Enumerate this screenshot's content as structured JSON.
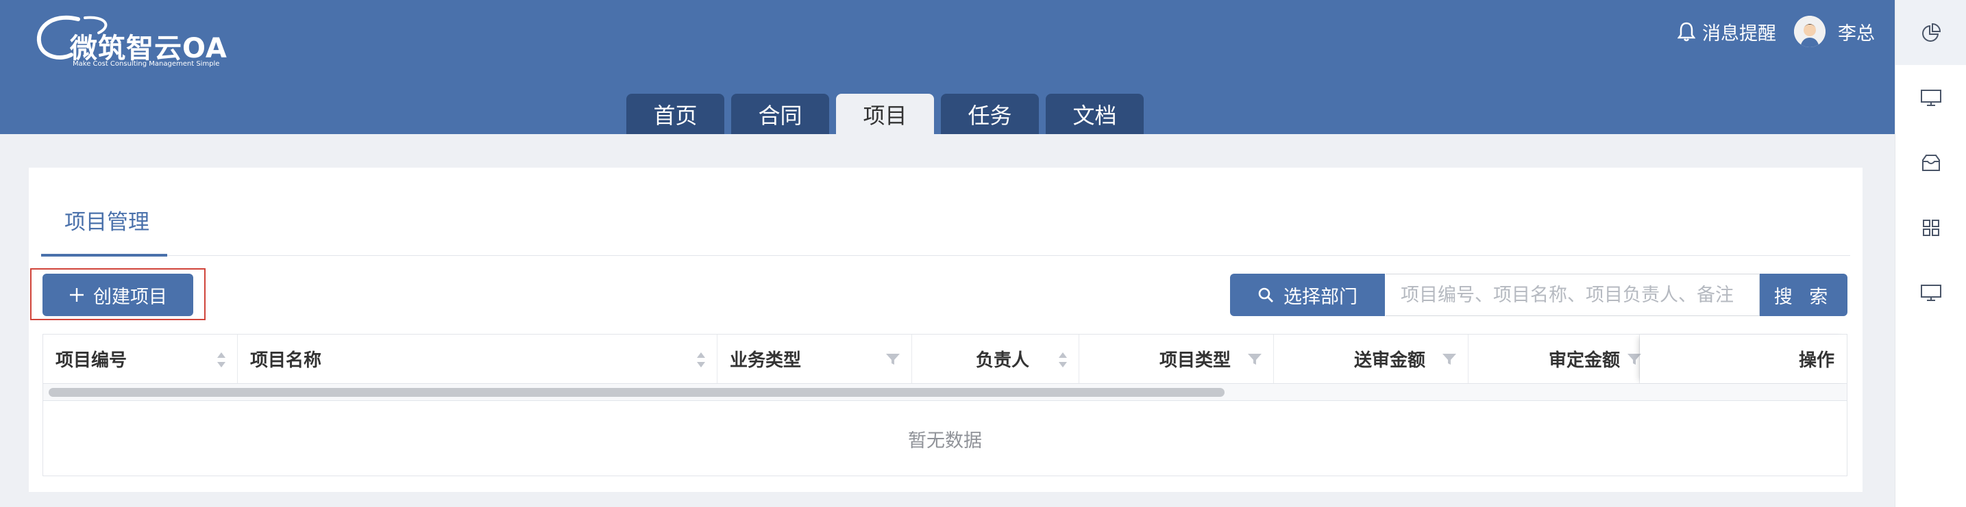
{
  "header": {
    "logo_text": "微筑智云OA",
    "logo_sub": "Make Cost Consulting Management Simple",
    "notice_label": "消息提醒",
    "user_name": "李总",
    "tabs": [
      {
        "label": "首页"
      },
      {
        "label": "合同"
      },
      {
        "label": "项目"
      },
      {
        "label": "任务"
      },
      {
        "label": "文档"
      }
    ]
  },
  "page": {
    "title": "项目管理",
    "create_label": "创建项目",
    "dept_label": "选择部门",
    "search_placeholder": "项目编号、项目名称、项目负责人、备注",
    "search_label": "搜 索",
    "columns": [
      {
        "label": "项目编号"
      },
      {
        "label": "项目名称"
      },
      {
        "label": "业务类型"
      },
      {
        "label": "负责人"
      },
      {
        "label": "项目类型"
      },
      {
        "label": "送审金额"
      },
      {
        "label": "审定金额"
      },
      {
        "label": "操作"
      }
    ],
    "empty_text": "暂无数据"
  },
  "colors": {
    "primary": "#4a71ab",
    "tab_dark": "#2f4d7c",
    "highlight_border": "#d0443a"
  }
}
